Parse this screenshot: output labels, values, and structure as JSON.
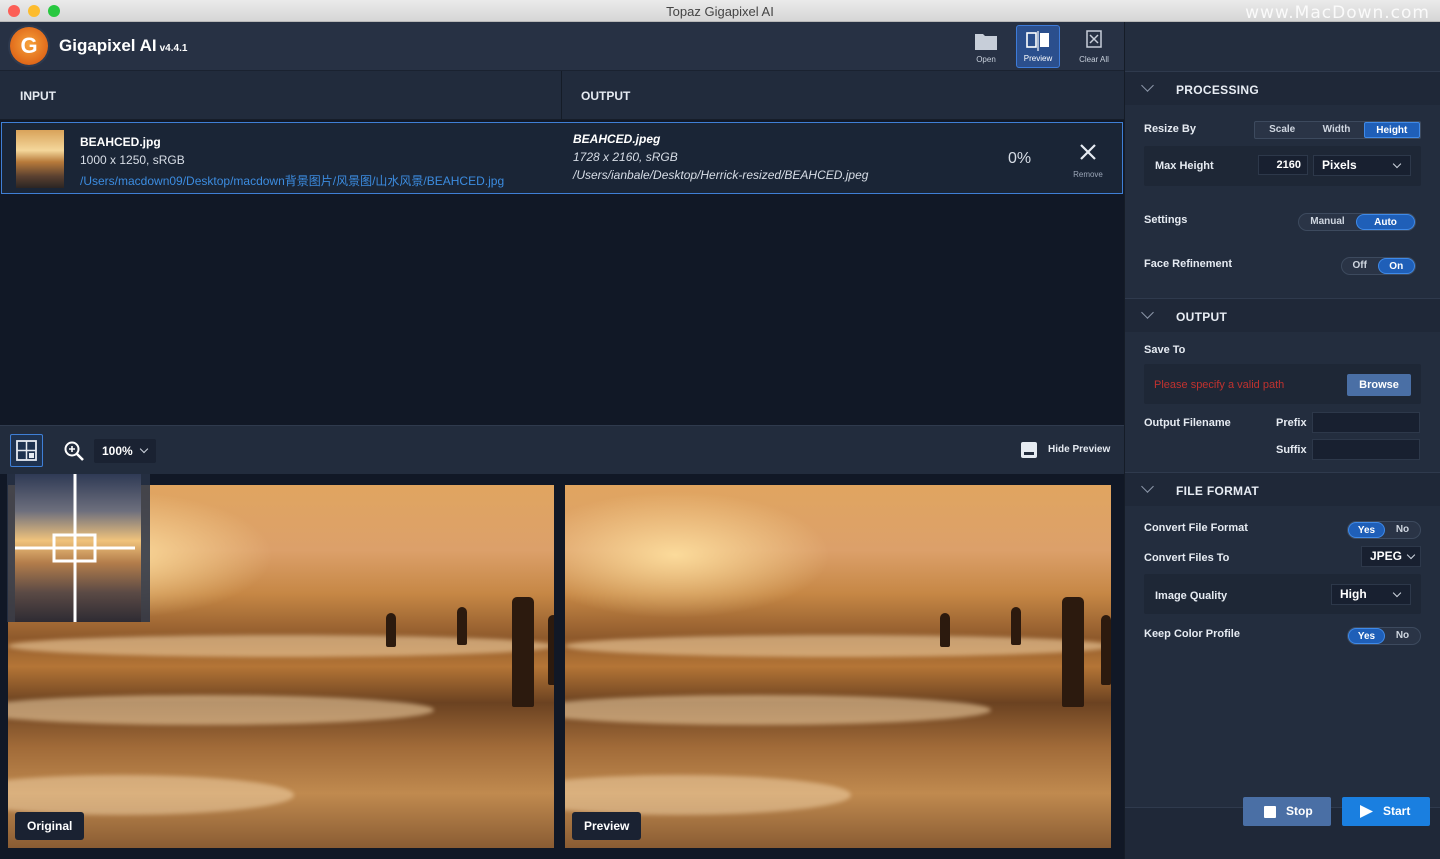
{
  "window": {
    "title": "Topaz Gigapixel AI",
    "watermark": "www.MacDown.com"
  },
  "app": {
    "name": "Gigapixel AI",
    "version": "v4.4.1",
    "logo_letter": "G"
  },
  "toolbar": {
    "open_label": "Open",
    "preview_label": "Preview",
    "clear_all_label": "Clear All"
  },
  "columns": {
    "input": "INPUT",
    "output": "OUTPUT"
  },
  "file": {
    "input_name": "BEAHCED.jpg",
    "input_meta": "1000 x 1250, sRGB",
    "input_path": "/Users/macdown09/Desktop/macdown背景图片/风景图/山水风景/BEAHCED.jpg",
    "output_name": "BEAHCED.jpeg",
    "output_meta": "1728 x 2160, sRGB",
    "output_path": "/Users/ianbale/Desktop/Herrick-resized/BEAHCED.jpeg",
    "progress": "0%",
    "remove_label": "Remove"
  },
  "preview_toolbar": {
    "zoom": "100%",
    "hide_preview_label": "Hide Preview"
  },
  "preview": {
    "original_label": "Original",
    "preview_label": "Preview"
  },
  "processing": {
    "header": "PROCESSING",
    "resize_by_label": "Resize By",
    "resize_options": [
      "Scale",
      "Width",
      "Height"
    ],
    "resize_selected": "Height",
    "max_height_label": "Max Height",
    "max_height_value": "2160",
    "unit": "Pixels",
    "settings_label": "Settings",
    "settings_options": [
      "Manual",
      "Auto"
    ],
    "settings_selected": "Auto",
    "face_label": "Face Refinement",
    "face_options": [
      "Off",
      "On"
    ],
    "face_selected": "On"
  },
  "output": {
    "header": "OUTPUT",
    "save_to_label": "Save To",
    "save_error": "Please specify a valid path",
    "browse_label": "Browse",
    "filename_label": "Output Filename",
    "prefix_label": "Prefix",
    "suffix_label": "Suffix"
  },
  "file_format": {
    "header": "FILE FORMAT",
    "convert_label": "Convert File Format",
    "convert_options": [
      "Yes",
      "No"
    ],
    "convert_selected": "Yes",
    "convert_to_label": "Convert Files To",
    "convert_to_value": "JPEG",
    "quality_label": "Image Quality",
    "quality_value": "High",
    "keep_profile_label": "Keep Color Profile",
    "keep_profile_options": [
      "Yes",
      "No"
    ],
    "keep_profile_selected": "Yes"
  },
  "actions": {
    "stop_label": "Stop",
    "start_label": "Start"
  },
  "colors": {
    "accent": "#1f5fb8",
    "error": "#c0322f",
    "link": "#3c8ce0",
    "start": "#1a7fe0"
  }
}
